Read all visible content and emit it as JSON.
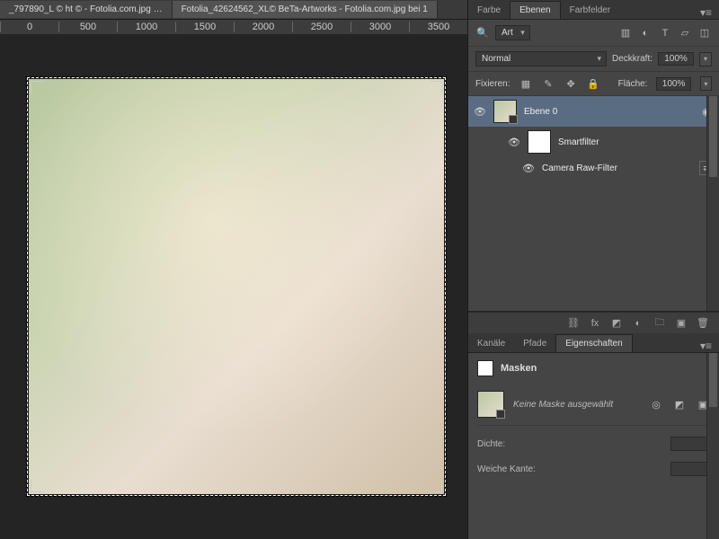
{
  "doc_tabs": [
    "_797890_L  © ht © - Fotolia.com.jpg …",
    "Fotolia_42624562_XL© BeTa-Artworks - Fotolia.com.jpg  bei 1"
  ],
  "ruler_ticks": [
    "0",
    "500",
    "1000",
    "1500",
    "2000",
    "2500",
    "3000",
    "3500"
  ],
  "panel_tabs_top": {
    "farbe": "Farbe",
    "ebenen": "Ebenen",
    "farbfelder": "Farbfelder"
  },
  "search": {
    "label": "Art"
  },
  "blend": {
    "mode": "Normal",
    "opacity_label": "Deckkraft:",
    "opacity_value": "100%"
  },
  "lock": {
    "label": "Fixieren:",
    "fill_label": "Fläche:",
    "fill_value": "100%"
  },
  "layers": {
    "layer0": "Ebene 0",
    "smartfilter": "Smartfilter",
    "camera_raw": "Camera Raw-Filter"
  },
  "lower_tabs": {
    "kanale": "Kanäle",
    "pfade": "Pfade",
    "eigenschaften": "Eigenschaften"
  },
  "props": {
    "masken": "Masken",
    "no_mask": "Keine Maske ausgewählt",
    "dichte": "Dichte:",
    "weiche_kante": "Weiche Kante:"
  }
}
